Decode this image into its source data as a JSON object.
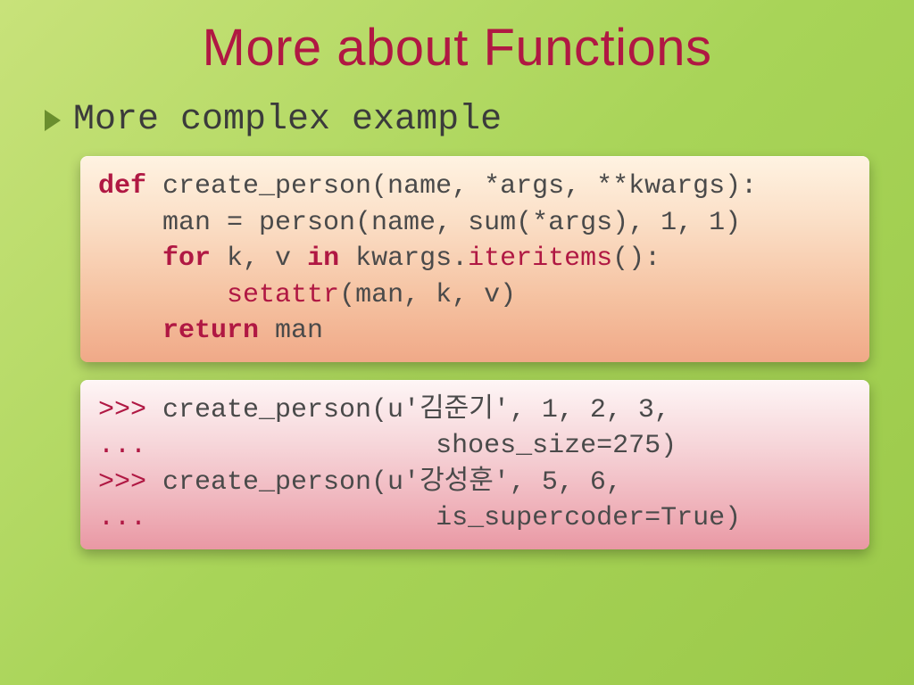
{
  "title": "More about Functions",
  "subtitle": "More complex example",
  "code1": {
    "l1_def": "def",
    "l1_rest": " create_person(name, *args, **kwargs):",
    "l2": "    man = person(name, sum(*args), 1, 1)",
    "l3_indent": "    ",
    "l3_for": "for",
    "l3_mid": " k, v ",
    "l3_in": "in",
    "l3_kwargs": " kwargs.",
    "l3_iter": "iteritems",
    "l3_end": "():",
    "l4_indent": "        ",
    "l4_fn": "setattr",
    "l4_rest": "(man, k, v)",
    "l5_indent": "    ",
    "l5_return": "return",
    "l5_rest": " man"
  },
  "code2": {
    "p1": ">>>",
    "l1": " create_person(u'김준기', 1, 2, 3,",
    "p2": "...",
    "l2": "                  shoes_size=275)",
    "p3": ">>>",
    "l3": " create_person(u'강성훈', 5, 6,",
    "p4": "...",
    "l4": "                  is_supercoder=True)"
  }
}
